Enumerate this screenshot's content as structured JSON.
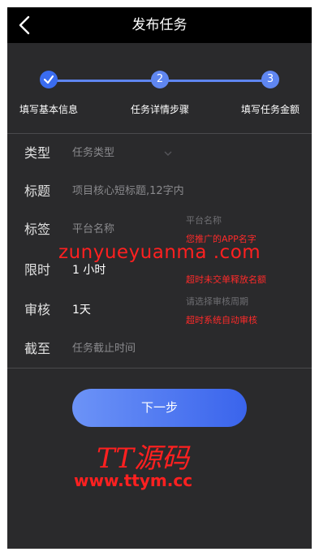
{
  "header": {
    "title": "发布任务"
  },
  "steps": [
    {
      "number": "",
      "label": "填写基本信息",
      "state": "done"
    },
    {
      "number": "2",
      "label": "任务详情步骤",
      "state": "pending"
    },
    {
      "number": "3",
      "label": "填写任务金额",
      "state": "pending"
    }
  ],
  "form": {
    "type": {
      "label": "类型",
      "placeholder": "任务类型"
    },
    "title": {
      "label": "标题",
      "placeholder": "项目核心短标题,12字内"
    },
    "tag": {
      "label": "标签",
      "placeholder": "平台名称"
    },
    "limit": {
      "label": "限时",
      "value": "1 小时"
    },
    "review": {
      "label": "审核",
      "value": "1天"
    },
    "deadline": {
      "label": "截至",
      "placeholder": "任务截止时间"
    }
  },
  "hints": {
    "platform_name": "平台名称",
    "app_name_note": "您推广的APP名字",
    "limit_note": "超时未交单释放名额",
    "review_select": "请选择审核周期",
    "review_note": "超时系统自动审核"
  },
  "button": {
    "next_label": "下一步"
  },
  "watermarks": {
    "site": "zunyueyuanma .com",
    "brand": "TT源码",
    "url": "www.ttym.cc"
  },
  "colors": {
    "accent": "#5f86f0",
    "header_bg": "#000000",
    "page_bg": "#2a2a2c",
    "note_red": "#ff2a2a"
  }
}
